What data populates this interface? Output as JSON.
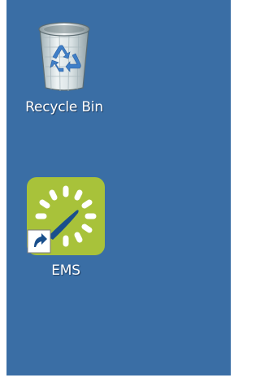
{
  "desktop": {
    "background_color": "#3a6ea5",
    "icons": [
      {
        "label": "Recycle Bin",
        "icon": "recycle-bin-icon"
      },
      {
        "label": "EMS",
        "icon": "ems-app-icon",
        "overlay": "shortcut-arrow-icon",
        "tile_color": "#a8c23a"
      }
    ]
  }
}
